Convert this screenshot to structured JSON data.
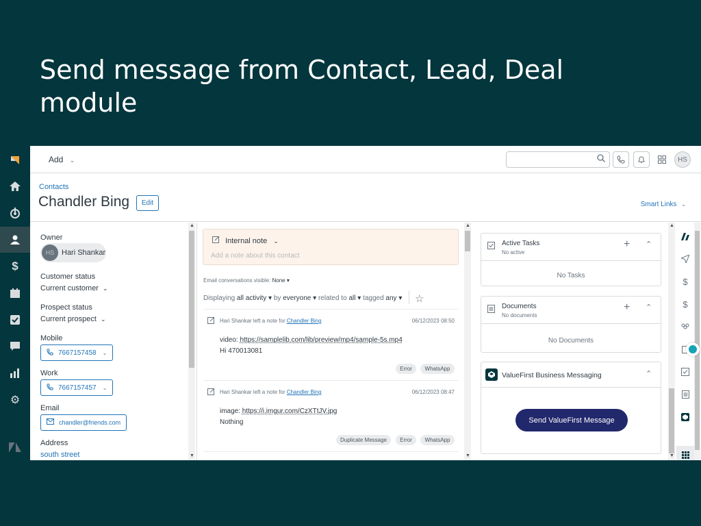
{
  "slide": {
    "title": "Send message from Contact, Lead, Deal module"
  },
  "leftnav": {
    "icons": [
      "zendesk-sell-logo-icon",
      "home-icon",
      "leads-icon",
      "contacts-icon",
      "deals-icon",
      "calendar-icon",
      "tasks-icon",
      "chat-icon",
      "reports-icon",
      "settings-icon",
      "zendesk-logo-icon"
    ],
    "active": "contacts-icon"
  },
  "topbar": {
    "add_label": "Add",
    "search_placeholder": "",
    "avatar_initials": "HS"
  },
  "header": {
    "breadcrumb": "Contacts",
    "contact_name": "Chandler Bing",
    "edit_label": "Edit",
    "smart_links_label": "Smart Links"
  },
  "details": {
    "owner_label": "Owner",
    "owner_initials": "HS",
    "owner_name": "Hari Shankar",
    "customer_status_label": "Customer status",
    "customer_status_value": "Current customer",
    "prospect_status_label": "Prospect status",
    "prospect_status_value": "Current prospect",
    "mobile_label": "Mobile",
    "mobile_value": "7667157458",
    "work_label": "Work",
    "work_value": "7667157457",
    "email_label": "Email",
    "email_value": "chandler@friends.com",
    "address_label": "Address",
    "address_value": "south street"
  },
  "activity": {
    "note_title": "Internal note",
    "note_placeholder": "Add a note about this contact",
    "email_visible_label": "Email conversations visible:",
    "email_visible_value": "None",
    "filter_displaying": "Displaying",
    "filter_activity": "all activity",
    "filter_by": "by",
    "filter_everyone": "everyone",
    "filter_related": "related to",
    "filter_all": "all",
    "filter_tagged": "tagged",
    "filter_any": "any",
    "items": [
      {
        "author_text": "Hari Shankar left a note for",
        "target": "Chandler Bing",
        "date": "06/12/2023 08:50",
        "line1_prefix": "video:",
        "line1_link": "https://samplelib.com/lib/preview/mp4/sample-5s.mp4",
        "line2": "Hi 470013081",
        "tags": [
          "Error",
          "WhatsApp"
        ]
      },
      {
        "author_text": "Hari Shankar left a note for",
        "target": "Chandler Bing",
        "date": "06/12/2023 08:47",
        "line1_prefix": "image:",
        "line1_link": "https://i.imgur.com/CzXTtJV.jpg",
        "line2": "Nothing",
        "tags": [
          "Duplicate Message",
          "Error",
          "WhatsApp"
        ]
      }
    ]
  },
  "cards": {
    "tasks_title": "Active Tasks",
    "tasks_sub": "No active",
    "tasks_empty": "No Tasks",
    "docs_title": "Documents",
    "docs_sub": "No documents",
    "docs_empty": "No Documents",
    "vf_title": "ValueFirst Business Messaging",
    "vf_button": "Send ValueFirst Message"
  },
  "colors": {
    "slide_bg": "#03363d",
    "link": "#1f73b7",
    "send_button": "#22286c",
    "note_bg": "#fdf3ea"
  }
}
